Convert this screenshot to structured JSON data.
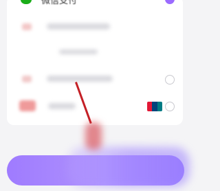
{
  "payment": {
    "wechat_label": "微信支付",
    "unionpay_colors": [
      "#e21836",
      "#00447c",
      "#007b84"
    ]
  },
  "colors": {
    "accent": "#9b6bff",
    "wechat_green": "#1aad19",
    "pointer_red": "#c42026"
  }
}
